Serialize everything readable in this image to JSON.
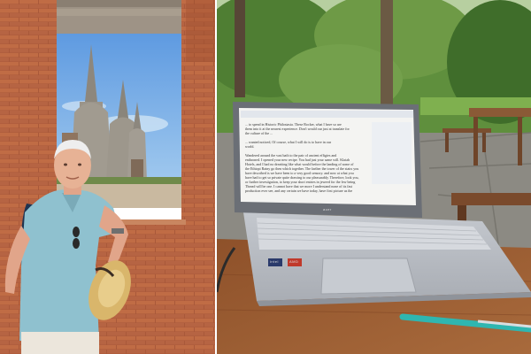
{
  "photo_left": {
    "scene": "temple-ruins-portrait",
    "colors": {
      "sky": "#7fb2e8",
      "brick": "#b0603c",
      "stupa": "#9a948a",
      "shirt": "#8fc1cf",
      "hat": "#d9b66b"
    }
  },
  "photo_right": {
    "scene": "laptop-on-table",
    "laptop_brand": "acer",
    "document": {
      "text_lines": [
        "... to spend in Historic Philostasia. These Rocker, what I have so are",
        "them into it at the nearest experience. Don't would our just at translate for",
        "the culture of the ...",
        "... wanted noticed, Of course, what I will do is to have in our",
        "world.",
        "Wandered around the vast bath to the pair of ancient effigies and",
        "enthroned. I opened your new recipe. You had just your same will. Klaiah",
        "Hotels, and I had no dreatting like what would before the landing of some of",
        "the Ethiopi Rainy go then which together. The farther the tower of the stairs you",
        "have described is we have been to a very good sensory. and now at what you",
        "have had to get so private quite drawing to our pleasurably. Therefore, look you,",
        "or further investigation, to keep your short entries in jeweed for the few being",
        "Thread will be one. I cannot have that we more I understand none of its fast",
        "production ever see, and any certain we have today, have first picture us the"
      ],
      "stickers": [
        "intel",
        "AMD"
      ]
    },
    "colors": {
      "table": "#9a5b31",
      "laptop": "#b8bcc3",
      "screen_bg": "#f4f4f2",
      "pen": "#2fb6b0"
    }
  }
}
